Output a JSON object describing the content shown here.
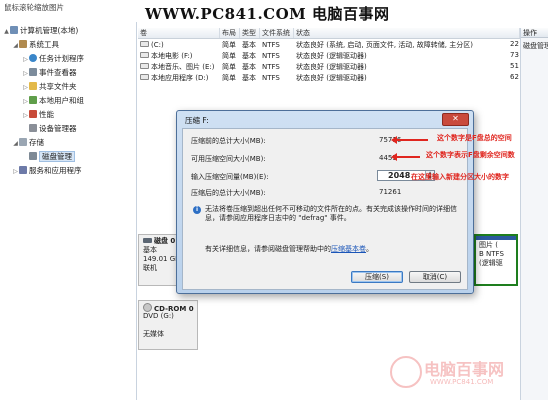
{
  "top_caption": "鼠标滚轮缩放图片",
  "site_watermark": "WWW.PC841.COM 电脑百事网",
  "tree": [
    {
      "label": "计算机管理(本地)",
      "toggle": "▲",
      "icon": "pc-icon",
      "indent": 0
    },
    {
      "label": "系统工具",
      "toggle": "◢",
      "icon": "tools-icon",
      "indent": 1
    },
    {
      "label": "任务计划程序",
      "toggle": "▷",
      "icon": "clock-icon",
      "indent": 2
    },
    {
      "label": "事件查看器",
      "toggle": "▷",
      "icon": "log-icon",
      "indent": 2
    },
    {
      "label": "共享文件夹",
      "toggle": "▷",
      "icon": "folder-icon",
      "indent": 2
    },
    {
      "label": "本地用户和组",
      "toggle": "▷",
      "icon": "users-icon",
      "indent": 2
    },
    {
      "label": "性能",
      "toggle": "▷",
      "icon": "performance-icon",
      "indent": 2
    },
    {
      "label": "设备管理器",
      "toggle": "",
      "icon": "device-icon",
      "indent": 2
    },
    {
      "label": "存储",
      "toggle": "◢",
      "icon": "storage-icon",
      "indent": 1
    },
    {
      "label": "磁盘管理",
      "toggle": "",
      "icon": "disk-icon",
      "indent": 2,
      "selected": true
    },
    {
      "label": "服务和应用程序",
      "toggle": "▷",
      "icon": "services-icon",
      "indent": 1
    }
  ],
  "volume_list": {
    "headers": [
      "卷",
      "布局",
      "类型",
      "文件系统",
      "状态"
    ],
    "rows": [
      {
        "vol": "(C:)",
        "layout": "简单",
        "type": "基本",
        "fs": "NTFS",
        "status": "状态良好 (系统, 启动, 页面文件, 活动, 故障转储, 主分区)"
      },
      {
        "vol": "本地电影 (F:)",
        "layout": "简单",
        "type": "基本",
        "fs": "NTFS",
        "status": "状态良好 (逻辑驱动器)"
      },
      {
        "vol": "本地音乐、图片 (E:)",
        "layout": "简单",
        "type": "基本",
        "fs": "NTFS",
        "status": "状态良好 (逻辑驱动器)"
      },
      {
        "vol": "本地应用程序 (D:)",
        "layout": "简单",
        "type": "基本",
        "fs": "NTFS",
        "status": "状态良好 (逻辑驱动器)"
      }
    ],
    "right_values": [
      "22",
      "73",
      "51",
      "62"
    ]
  },
  "actions": {
    "title": "操作",
    "items": [
      "磁盘管理"
    ]
  },
  "disks": {
    "disk0": {
      "name": "磁盘 0",
      "type": "基本",
      "size": "149.01 GE",
      "status": "联机"
    },
    "disk0_partition_f": {
      "title": "图片 (",
      "line2": "B NTFS",
      "line3": "(逻辑驱"
    },
    "cdrom": {
      "name": "CD-ROM 0",
      "type": "DVD (G:)",
      "status": "无媒体"
    }
  },
  "dialog": {
    "title": "压缩 F:",
    "close": "✕",
    "fields": {
      "total_before_label": "压缩前的总计大小(MB):",
      "total_before_value": "75716",
      "available_label": "可用压缩空间大小(MB):",
      "available_value": "4455",
      "input_label": "输入压缩空间量(MB)(E):",
      "input_value": "2048",
      "total_after_label": "压缩后的总计大小(MB):",
      "total_after_value": "71261"
    },
    "message": "无法将卷压缩到超出任何不可移动的文件所在的点。有关完成该操作时间的详细信息，请参阅应用程序日志中的 \"defrag\" 事件。",
    "more_prefix": "有关详细信息，请参阅磁盘管理帮助中的",
    "more_link": "压缩基本卷",
    "more_suffix": "。",
    "shrink_button": "压缩(S)",
    "cancel_button": "取消(C)"
  },
  "annotations": {
    "a1": "这个数字是F盘总的空间",
    "a2": "这个数字表示F盘剩余空间数",
    "a3": "在这里输入新建分区大小的数字"
  },
  "watermark_br": {
    "text": "电脑百事网",
    "url": "WWW.PC841.COM"
  },
  "colors": {
    "accent": "#2b5a9e",
    "annotation": "#e0261f",
    "selected_partition": "#1e7e1e"
  }
}
